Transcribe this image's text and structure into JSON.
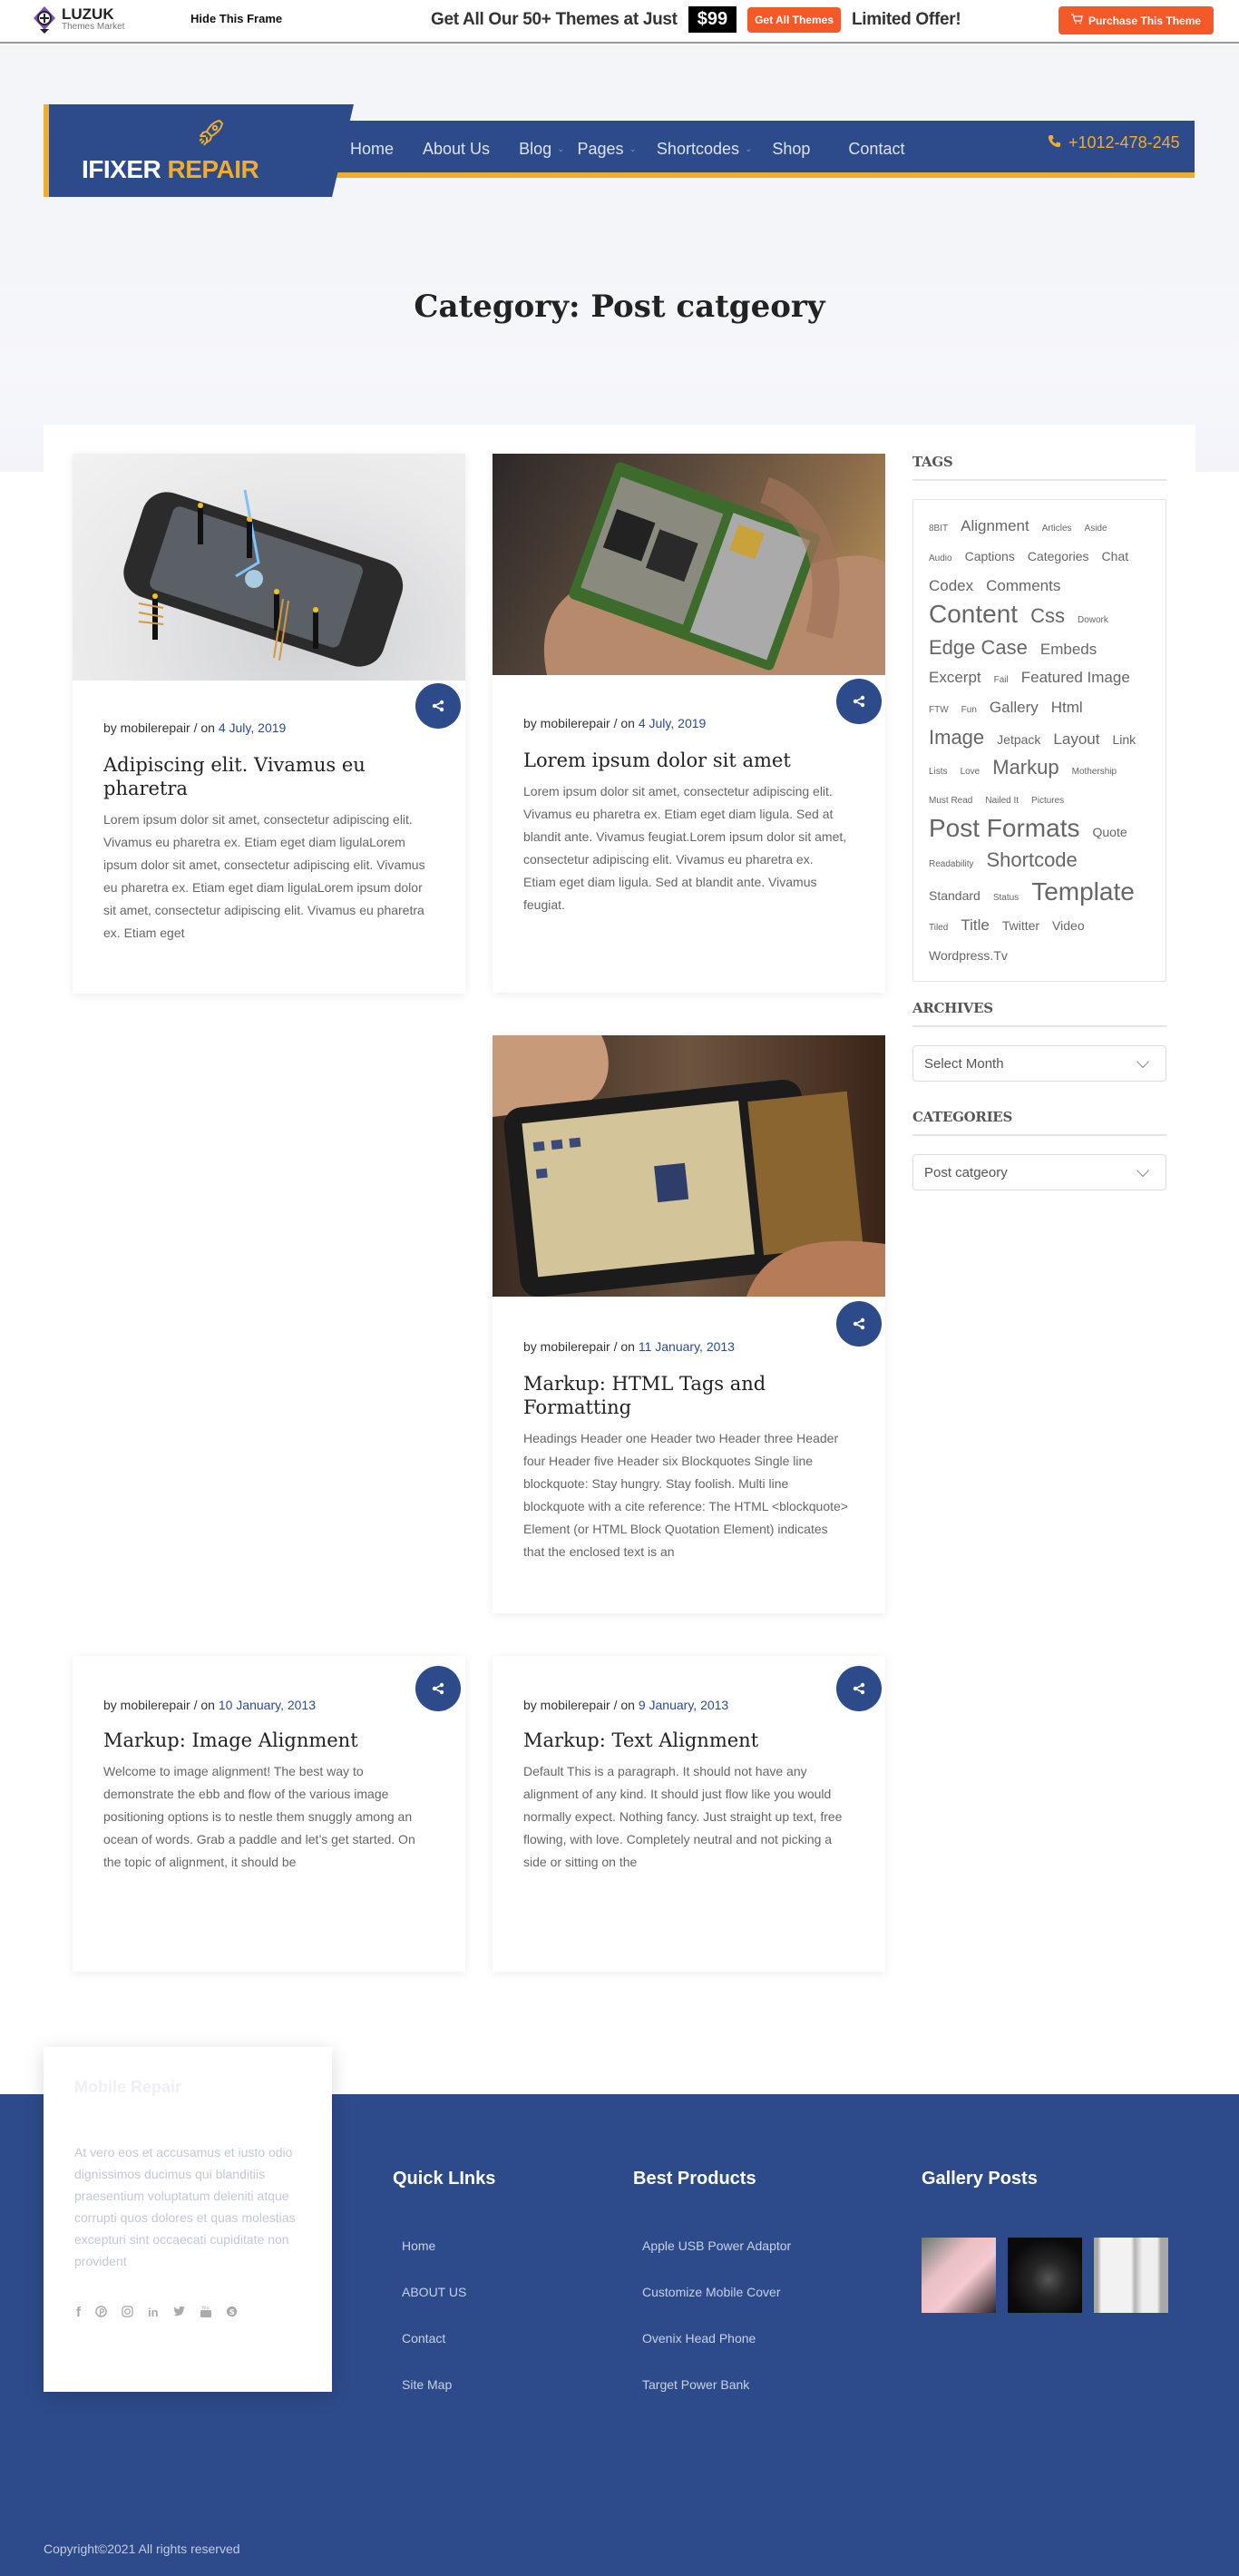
{
  "topbar": {
    "brand": "LUZUK",
    "brand_sub": "Themes Market",
    "hide_frame": "Hide This Frame",
    "promo_text": "Get All Our 50+ Themes at Just",
    "price": "$99",
    "get_all_label": "Get All Themes",
    "offer_text": "Limited Offer!",
    "purchase_label": "Purchase This Theme",
    "accent": "#f45a27"
  },
  "header": {
    "logo_white": "IFIXER",
    "logo_yellow": "REPAIR",
    "menu": [
      {
        "label": "Home",
        "dropdown": false
      },
      {
        "label": "About Us",
        "dropdown": false
      },
      {
        "label": "Blog",
        "dropdown": true
      },
      {
        "label": "Pages",
        "dropdown": true
      },
      {
        "label": "Shortcodes",
        "dropdown": true
      },
      {
        "label": "Shop",
        "dropdown": false
      },
      {
        "label": "Contact",
        "dropdown": false
      }
    ],
    "phone": "+1012-478-245",
    "brand_color": "#2d4b8a",
    "accent_color": "#efad30"
  },
  "page": {
    "title": "Category: Post catgeory"
  },
  "posts": [
    {
      "author_prefix": "by mobilerepair / on ",
      "date": "4 July, 2019",
      "title": "Adipiscing elit. Vivamus eu pharetra",
      "excerpt": "Lorem ipsum dolor sit amet, consectetur adipiscing elit. Vivamus eu pharetra ex. Etiam eget diam ligulaLorem ipsum dolor sit amet, consectetur adipiscing elit. Vivamus eu pharetra ex. Etiam eget diam ligulaLorem ipsum dolor sit amet, consectetur adipiscing elit. Vivamus eu pharetra ex. Etiam eget",
      "image": "phone-with-miniature-workers"
    },
    {
      "author_prefix": "by mobilerepair / on ",
      "date": "4 July, 2019",
      "title": "Lorem ipsum dolor sit amet",
      "excerpt": "Lorem ipsum dolor sit amet, consectetur adipiscing elit. Vivamus eu pharetra ex. Etiam eget diam ligula. Sed at blandit ante. Vivamus feugiat.Lorem ipsum dolor sit amet, consectetur adipiscing elit. Vivamus eu pharetra ex. Etiam eget diam ligula. Sed at blandit ante. Vivamus feugiat.",
      "image": "circuit-board-in-hand"
    },
    {
      "author_prefix": "by mobilerepair / on ",
      "date": "11 January, 2013",
      "title": "Markup: HTML Tags and Formatting",
      "excerpt": "Headings Header one Header two Header three Header four Header five Header six Blockquotes Single line blockquote: Stay hungry. Stay foolish. Multi line blockquote with a cite reference: The HTML <blockquote> Element (or HTML Block Quotation Element) indicates that the enclosed text is an",
      "image": "disassembled-phone-screen"
    },
    {
      "author_prefix": "by mobilerepair / on ",
      "date": "10 January, 2013",
      "title": "Markup: Image Alignment",
      "excerpt": "Welcome to image alignment! The best way to demonstrate the ebb and flow of the various image positioning options is to nestle them snuggly among an ocean of words. Grab a paddle and let’s get started. On the topic of alignment, it should be"
    },
    {
      "author_prefix": "by mobilerepair / on ",
      "date": "9 January, 2013",
      "title": "Markup: Text Alignment",
      "excerpt": "Default This is a paragraph. It should not have any alignment of any kind. It should just flow like you would normally expect. Nothing fancy. Just straight up text, free flowing, with love. Completely neutral and not picking a side or sitting on the"
    }
  ],
  "sidebar": {
    "tags_title": "TAGS",
    "tags": [
      {
        "label": "8BIT",
        "size": "xs"
      },
      {
        "label": "Alignment",
        "size": "m"
      },
      {
        "label": "Articles",
        "size": "xs"
      },
      {
        "label": "Aside",
        "size": "xs"
      },
      {
        "label": "Audio",
        "size": "xs"
      },
      {
        "label": "Captions",
        "size": "s"
      },
      {
        "label": "Categories",
        "size": "s"
      },
      {
        "label": "Chat",
        "size": "s"
      },
      {
        "label": "Codex",
        "size": "m"
      },
      {
        "label": "Comments",
        "size": "m"
      },
      {
        "label": "Content",
        "size": "xl"
      },
      {
        "label": "Css",
        "size": "l"
      },
      {
        "label": "Dowork",
        "size": "xs"
      },
      {
        "label": "Edge Case",
        "size": "l"
      },
      {
        "label": "Embeds",
        "size": "m"
      },
      {
        "label": "Excerpt",
        "size": "m"
      },
      {
        "label": "Fail",
        "size": "xs"
      },
      {
        "label": "Featured Image",
        "size": "m"
      },
      {
        "label": "FTW",
        "size": "xs"
      },
      {
        "label": "Fun",
        "size": "xs"
      },
      {
        "label": "Gallery",
        "size": "m"
      },
      {
        "label": "Html",
        "size": "m"
      },
      {
        "label": "Image",
        "size": "l"
      },
      {
        "label": "Jetpack",
        "size": "s"
      },
      {
        "label": "Layout",
        "size": "m"
      },
      {
        "label": "Link",
        "size": "s"
      },
      {
        "label": "Lists",
        "size": "xs"
      },
      {
        "label": "Love",
        "size": "xs"
      },
      {
        "label": "Markup",
        "size": "l"
      },
      {
        "label": "Mothership",
        "size": "xs"
      },
      {
        "label": "Must Read",
        "size": "xs"
      },
      {
        "label": "Nailed It",
        "size": "xs"
      },
      {
        "label": "Pictures",
        "size": "xs"
      },
      {
        "label": "Post Formats",
        "size": "xl"
      },
      {
        "label": "Quote",
        "size": "s"
      },
      {
        "label": "Readability",
        "size": "xs"
      },
      {
        "label": "Shortcode",
        "size": "l"
      },
      {
        "label": "Standard",
        "size": "s"
      },
      {
        "label": "Status",
        "size": "xs"
      },
      {
        "label": "Template",
        "size": "xl"
      },
      {
        "label": "Tiled",
        "size": "xs"
      },
      {
        "label": "Title",
        "size": "m"
      },
      {
        "label": "Twitter",
        "size": "s"
      },
      {
        "label": "Video",
        "size": "s"
      },
      {
        "label": "Wordpress.Tv",
        "size": "s"
      }
    ],
    "archives_title": "ARCHIVES",
    "archives_select": "Select Month",
    "categories_title": "CATEGORIES",
    "categories_select": "Post catgeory"
  },
  "footer": {
    "about_title": "Mobile Repair",
    "about_text": "At vero eos et accusamus et iusto odio dignissimos ducimus qui blanditiis praesentium voluptatum deleniti atque corrupti quos dolores et quas molestias excepturi sint occaecati cupiditate non provident",
    "socials": [
      "facebook",
      "pinterest",
      "instagram",
      "linkedin",
      "twitter",
      "youtube",
      "skype"
    ],
    "quick_links_title": "Quick LInks",
    "quick_links": [
      "Home",
      "ABOUT US",
      "Contact",
      "Site Map"
    ],
    "products_title": "Best Products",
    "products": [
      "Apple USB Power Adaptor",
      "Customize Mobile Cover",
      "Ovenix Head Phone",
      "Target Power Bank"
    ],
    "gallery_title": "Gallery Posts",
    "gallery": [
      "pink-phone-case",
      "black-headphones",
      "white-power-adaptor"
    ],
    "copyright": "Copyright©2021 All rights reserved"
  }
}
